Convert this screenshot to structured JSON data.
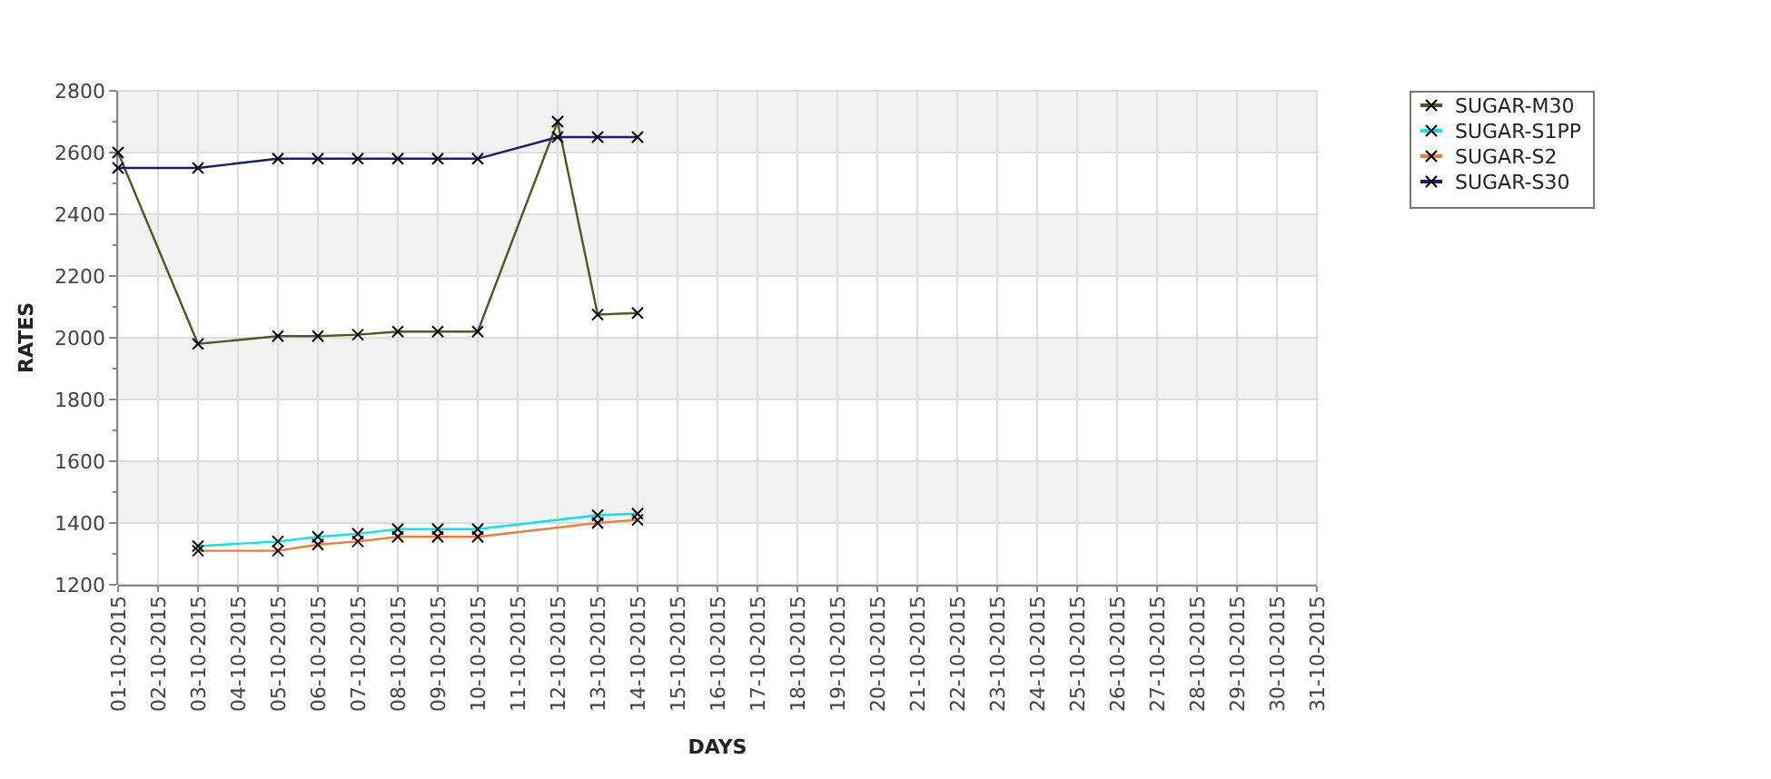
{
  "chart_data": {
    "type": "line",
    "xlabel": "DAYS",
    "ylabel": "RATES",
    "categories": [
      "01-10-2015",
      "02-10-2015",
      "03-10-2015",
      "04-10-2015",
      "05-10-2015",
      "06-10-2015",
      "07-10-2015",
      "08-10-2015",
      "09-10-2015",
      "10-10-2015",
      "11-10-2015",
      "12-10-2015",
      "13-10-2015",
      "14-10-2015",
      "15-10-2015",
      "16-10-2015",
      "17-10-2015",
      "18-10-2015",
      "19-10-2015",
      "20-10-2015",
      "21-10-2015",
      "22-10-2015",
      "23-10-2015",
      "24-10-2015",
      "25-10-2015",
      "26-10-2015",
      "27-10-2015",
      "28-10-2015",
      "29-10-2015",
      "30-10-2015",
      "31-10-2015"
    ],
    "series": [
      {
        "name": "SUGAR-M30",
        "color": "#4b5a1e",
        "marker": "x",
        "values": [
          2600,
          null,
          1980,
          null,
          2005,
          2005,
          2010,
          2020,
          2020,
          2020,
          null,
          2700,
          2075,
          2080,
          null,
          null,
          null,
          null,
          null,
          null,
          null,
          null,
          null,
          null,
          null,
          null,
          null,
          null,
          null,
          null,
          null
        ]
      },
      {
        "name": "SUGAR-S1PP",
        "color": "#00e6e6",
        "marker": "x",
        "values": [
          null,
          null,
          1325,
          null,
          1340,
          1355,
          1365,
          1380,
          1380,
          1380,
          null,
          null,
          1425,
          1430,
          null,
          null,
          null,
          null,
          null,
          null,
          null,
          null,
          null,
          null,
          null,
          null,
          null,
          null,
          null,
          null,
          null
        ]
      },
      {
        "name": "SUGAR-S2",
        "color": "#e8803c",
        "marker": "x",
        "values": [
          null,
          null,
          1310,
          null,
          1310,
          1330,
          1340,
          1355,
          1355,
          1355,
          null,
          null,
          1400,
          1410,
          null,
          null,
          null,
          null,
          null,
          null,
          null,
          null,
          null,
          null,
          null,
          null,
          null,
          null,
          null,
          null,
          null
        ]
      },
      {
        "name": "SUGAR-S30",
        "color": "#1a1a70",
        "marker": "x",
        "values": [
          2550,
          null,
          2550,
          null,
          2580,
          2580,
          2580,
          2580,
          2580,
          2580,
          null,
          2650,
          2650,
          2650,
          null,
          null,
          null,
          null,
          null,
          null,
          null,
          null,
          null,
          null,
          null,
          null,
          null,
          null,
          null,
          null,
          null
        ]
      }
    ],
    "grid": true,
    "legend": true,
    "ylim": [
      1200,
      2800
    ],
    "yticks": [
      1200,
      1400,
      1600,
      1800,
      2000,
      2200,
      2400,
      2600,
      2800
    ]
  }
}
